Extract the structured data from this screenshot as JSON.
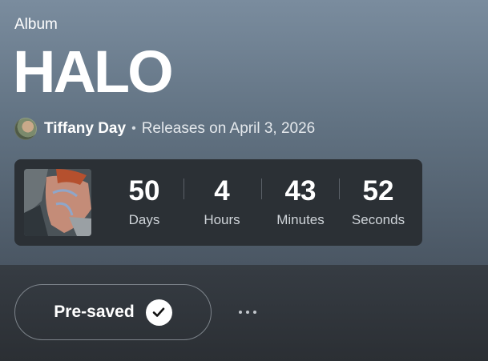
{
  "album": {
    "type_label": "Album",
    "title": "HALO",
    "artist": "Tiffany Day",
    "separator": "•",
    "release_text": "Releases on April 3, 2026"
  },
  "countdown": {
    "units": [
      {
        "value": "50",
        "label": "Days"
      },
      {
        "value": "4",
        "label": "Hours"
      },
      {
        "value": "43",
        "label": "Minutes"
      },
      {
        "value": "52",
        "label": "Seconds"
      }
    ]
  },
  "actions": {
    "presave_label": "Pre-saved",
    "presave_icon": "check-circle-icon",
    "more_icon": "more-options-icon"
  },
  "colors": {
    "header_top": "#7a8c9e",
    "countdown_bg": "#2b3035",
    "bottom_bg": "#2b2f34"
  }
}
